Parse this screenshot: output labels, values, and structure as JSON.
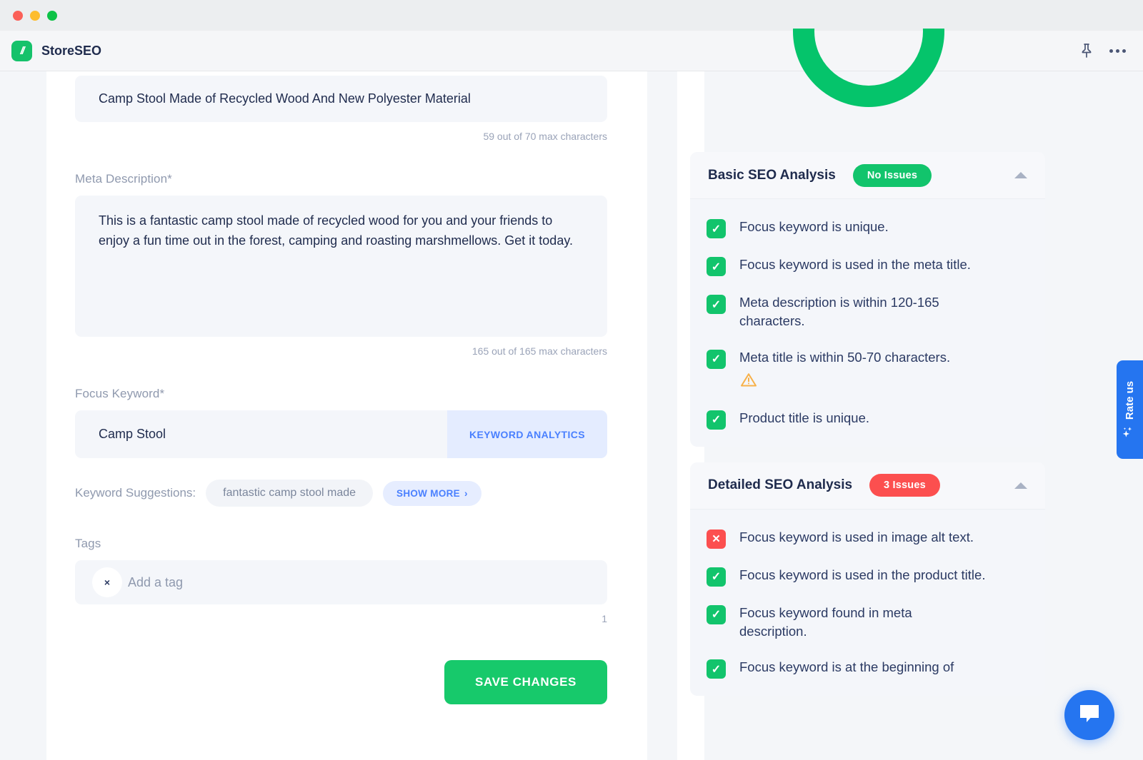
{
  "window": {
    "traffic_lights": [
      "close",
      "minimize",
      "zoom"
    ]
  },
  "appbar": {
    "brand_name": "StoreSEO",
    "logo_glyph": "//",
    "pin_icon": "pin-icon",
    "more_icon": "more-options-icon"
  },
  "form": {
    "meta_title": {
      "value": "Camp Stool Made of Recycled Wood And New Polyester Material",
      "counter": "59 out of 70 max characters"
    },
    "meta_description": {
      "label": "Meta Description*",
      "value": "This is a fantastic camp stool made of recycled wood for you and your friends to enjoy a fun time out in the forest, camping and roasting marshmellows. Get it today.",
      "counter": "165 out of 165 max characters"
    },
    "focus_keyword": {
      "label": "Focus Keyword*",
      "value": "Camp Stool",
      "analytics_button": "KEYWORD ANALYTICS"
    },
    "keyword_suggestions": {
      "label": "Keyword Suggestions:",
      "chips": [
        "fantastic camp stool made"
      ],
      "show_more": "SHOW MORE",
      "show_more_chevron": "›"
    },
    "tags": {
      "label": "Tags",
      "remove_glyph": "×",
      "placeholder": "Add a tag",
      "count": "1"
    },
    "save_button": "SAVE CHANGES"
  },
  "analysis": {
    "basic": {
      "title": "Basic SEO Analysis",
      "badge": "No Issues",
      "badge_status": "ok",
      "badge_color": "#12c46c",
      "collapse_icon": "chevron-up-icon",
      "items": [
        {
          "status": "pass",
          "text": "Focus keyword is unique.",
          "warning": false
        },
        {
          "status": "pass",
          "text": "Focus keyword is used in the meta title.",
          "warning": false
        },
        {
          "status": "pass",
          "text": "Meta description is within 120-165 characters.",
          "warning": false
        },
        {
          "status": "pass",
          "text": "Meta title is within 50-70 characters.",
          "warning": true
        },
        {
          "status": "pass",
          "text": "Product title is unique.",
          "warning": false
        }
      ]
    },
    "detailed": {
      "title": "Detailed SEO Analysis",
      "badge": "3 Issues",
      "badge_status": "err",
      "badge_color": "#fc4f4f",
      "collapse_icon": "chevron-up-icon",
      "items": [
        {
          "status": "fail",
          "text": "Focus keyword is used in image alt text.",
          "warning": false
        },
        {
          "status": "pass",
          "text": "Focus keyword is used in the product title.",
          "warning": false
        },
        {
          "status": "pass",
          "text": "Focus keyword found in meta description.",
          "warning": false
        },
        {
          "status": "pass",
          "text": "Focus keyword is at the beginning of",
          "warning": false
        }
      ]
    }
  },
  "widgets": {
    "rate_us": "Rate us",
    "rate_us_icon": "sparkle-icon",
    "chat_icon": "chat-bubble-icon"
  },
  "icons": {
    "check": "✓",
    "cross": "✕"
  },
  "colors": {
    "accent_green": "#12c46c",
    "accent_blue": "#2575f0",
    "danger_red": "#fc4f4f",
    "warning_orange": "#f5a623",
    "text_dark": "#1f2b4d",
    "text_muted": "#8f99ae"
  }
}
